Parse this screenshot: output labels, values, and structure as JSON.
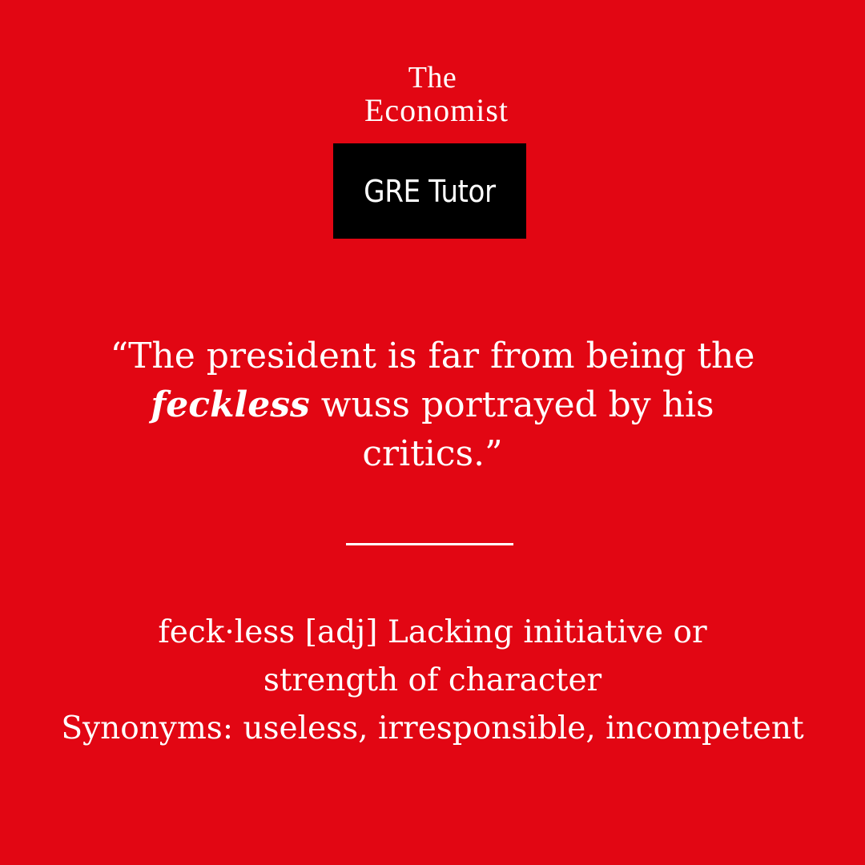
{
  "colors": {
    "background": "#e20613",
    "badge_background": "#000000",
    "text": "#ffffff"
  },
  "logo": {
    "line1": "The",
    "line2": "Economist"
  },
  "badge": {
    "label": "GRE Tutor"
  },
  "quote": {
    "line1": "“The president is far from being the",
    "keyword": "feckless",
    "line2_rest": " wuss portrayed by his",
    "line3": "critics.”"
  },
  "definition": {
    "line1": "feck·less [adj] Lacking initiative or",
    "line2": "strength of character",
    "synonyms": "Synonyms: useless, irresponsible, incompetent"
  }
}
